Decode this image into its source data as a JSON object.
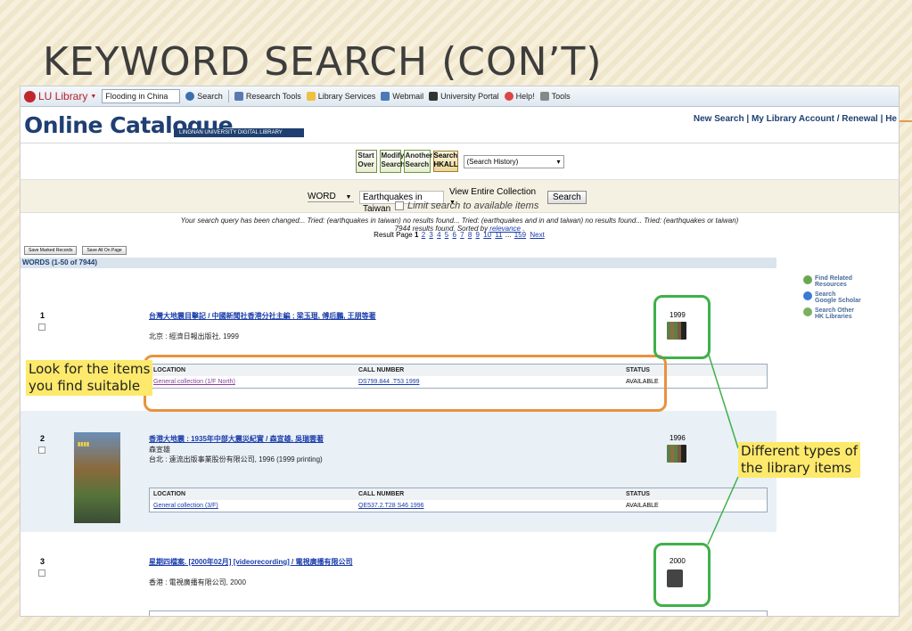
{
  "slide": {
    "title": "KEYWORD SEARCH (CON’T)"
  },
  "toolbar": {
    "lu_label": "LU Library",
    "search_box": "Flooding in China",
    "search_label": "Search",
    "research_tools": "Research Tools",
    "library_services": "Library Services",
    "webmail": "Webmail",
    "university_portal": "University Portal",
    "help": "Help!",
    "tools": "Tools"
  },
  "header": {
    "logo": "Online Catalogue",
    "logo_sub": "LINGNAN UNIVERSITY DIGITAL LIBRARY",
    "new_search": "New Search",
    "account": "My Library Account / Renewal",
    "help": "He"
  },
  "buttons": {
    "start_over_1": "Start",
    "start_over_2": "Over",
    "modify_1": "Modify",
    "modify_2": "Search",
    "another_1": "Another",
    "another_2": "Search",
    "hkall_1": "Search",
    "hkall_2": "HKALL",
    "history": "(Search History)"
  },
  "query": {
    "field": "WORD",
    "term": "Earthquakes in Taiwan",
    "collection": "View Entire Collection",
    "search_btn": "Search",
    "limit": "Limit search to available items"
  },
  "changed": {
    "line1": "Your search query has been changed... Tried: (earthquakes in taiwan) no results found... Tried: (earthquakes and in and taiwan) no results found... Tried: (earthquakes or taiwan)",
    "line2_a": "7944 results found. Sorted by ",
    "line2_link": "relevance",
    "line2_b": " ."
  },
  "pager": {
    "label": "Result Page",
    "current": "1",
    "pages": [
      "2",
      "3",
      "4",
      "5",
      "6",
      "7",
      "8",
      "9",
      "10",
      "11"
    ],
    "ellipsis": "...",
    "last": "159",
    "next": "Next"
  },
  "save": {
    "marked": "Save Marked Records",
    "all": "Save All On Page"
  },
  "words_bar": "WORDS (1-50 of 7944)",
  "side_links": [
    {
      "line1": "Find Related",
      "line2": "Resources"
    },
    {
      "line1": "Search",
      "line2": "Google Scholar"
    },
    {
      "line1": "Search Other",
      "line2": "HK Libraries"
    }
  ],
  "records": [
    {
      "num": "1",
      "title": "台灣大地震目擊記 / 中國新聞社香港分社主編 ; 梁玉琨, 傅后鵬, 王朋等著",
      "imprint": "北京 : 經濟日報出版社, 1999",
      "year": "1999",
      "type": "BOOK",
      "location": "General collection (1/F North)",
      "call_number": "DS799.844 .T53 1999",
      "status": "AVAILABLE"
    },
    {
      "num": "2",
      "title": "香港大地震 : 1935年中部大震災紀實 / 森宣雄, 吳瑞雲著",
      "author": "森宣雄",
      "imprint": "台北 : 遠流出版事業股份有限公司, 1996 (1999 printing)",
      "year": "1996",
      "type": "BOOK",
      "location": "General collection (3/F)",
      "call_number": "QE537.2.T28 S46 1996",
      "status": "AVAILABLE"
    },
    {
      "num": "3",
      "title": "星期四檔案. [2000年02月] [videorecording] / 電視廣播有限公司",
      "imprint": "香港 : 電視廣播有限公司, 2000",
      "year": "2000",
      "type": "VIDEO"
    }
  ],
  "table_headers": {
    "location": "LOCATION",
    "call_number": "CALL NUMBER",
    "status": "STATUS"
  },
  "annotations": {
    "left_label_1": "Look for the items",
    "left_label_2": "you find suitable",
    "right_label_1": "Different types of",
    "right_label_2": "the library items"
  },
  "colors": {
    "annotation_orange": "#e8923e",
    "annotation_green": "#3fb04a",
    "label_yellow": "#fde96b",
    "catalogue_blue": "#1f3f73"
  }
}
